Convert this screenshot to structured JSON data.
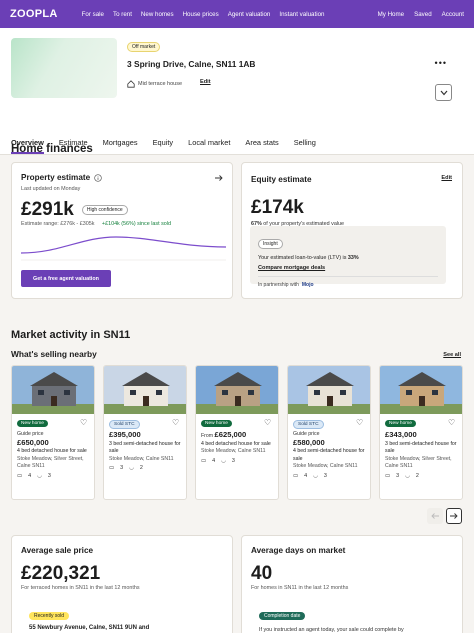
{
  "nav": {
    "logo": "ZOOPLA",
    "links": [
      "For sale",
      "To rent",
      "New homes",
      "House prices",
      "Agent valuation",
      "Instant valuation"
    ],
    "right": [
      "My Home",
      "Saved",
      "Account"
    ]
  },
  "property": {
    "status_badge": "Off market",
    "address": "3 Spring Drive, Calne, SN11 1AB",
    "type": "Mid terrace house",
    "edit_label": "Edit"
  },
  "tabs": [
    "Overview",
    "Estimate",
    "Mortgages",
    "Equity",
    "Local market",
    "Area stats",
    "Selling"
  ],
  "home_finances": {
    "heading": "Home finances",
    "estimate": {
      "title": "Property estimate",
      "updated": "Last updated on Monday",
      "value": "£291k",
      "confidence": "High confidence",
      "range": "Estimate range: £276k - £305k",
      "change": "+£104k (56%) since last sold",
      "cta": "Get a free agent valuation"
    },
    "equity": {
      "title": "Equity estimate",
      "edit_label": "Edit",
      "value": "£174k",
      "pct": "67%",
      "pct_suffix": " of your property's estimated value",
      "insight_tag": "Insight",
      "ltv_text": "Your estimated loan-to-value (LTV) is ",
      "ltv_value": "33%",
      "compare_link": "Compare mortgage deals",
      "partnership": "In partnership with",
      "partner": "Mojo"
    }
  },
  "market": {
    "heading": "Market activity in SN11",
    "subheading": "What's selling nearby",
    "see_all": "See all",
    "listings": [
      {
        "badge": "New home",
        "badge_type": "new",
        "price_prefix": "Guide price",
        "price": "£650,000",
        "desc": "4 bed detached house for sale",
        "location": "Stoke Meadow, Silver Street, Calne SN11",
        "beds": "4",
        "baths": "3",
        "photo_sky": "#8fb4d9",
        "photo_house": "#6b6f77"
      },
      {
        "badge": "Sold STC",
        "badge_type": "stc",
        "price_prefix": "",
        "price": "£395,000",
        "desc": "3 bed semi-detached house for sale",
        "location": "Stoke Meadow, Calne SN11",
        "beds": "3",
        "baths": "2",
        "photo_sky": "#c9d6e6",
        "photo_house": "#ece8df"
      },
      {
        "badge": "New home",
        "badge_type": "new",
        "price_prefix": "From ",
        "price": "£625,000",
        "desc": "4 bed detached house for sale",
        "location": "Stoke Meadow, Calne SN11",
        "beds": "4",
        "baths": "3",
        "photo_sky": "#7aa6d6",
        "photo_house": "#b9a184"
      },
      {
        "badge": "Sold STC",
        "badge_type": "stc",
        "price_prefix": "Guide price",
        "price": "£580,000",
        "desc": "4 bed semi-detached house for sale",
        "location": "Stoke Meadow, Calne SN11",
        "beds": "4",
        "baths": "3",
        "photo_sky": "#a9c4e4",
        "photo_house": "#e8e2d6"
      },
      {
        "badge": "New home",
        "badge_type": "new",
        "price_prefix": "",
        "price": "£343,000",
        "desc": "3 bed semi-detached house for sale",
        "location": "Stoke Meadow, Silver Street, Calne SN11",
        "beds": "3",
        "baths": "2",
        "photo_sky": "#8fb7df",
        "photo_house": "#c9a77b"
      }
    ]
  },
  "stats": {
    "avg_price_title": "Average sale price",
    "avg_price": "£220,321",
    "avg_price_note": "For terraced homes in SN11 in the last 12 months",
    "recent_badge": "Recently sold",
    "recent_addr": "55 Newbury Avenue, Calne, SN11 9UN and",
    "avg_days_title": "Average days on market",
    "avg_days": "40",
    "avg_days_note": "For homes in SN11 in the last 12 months",
    "completion_badge": "Completion date",
    "completion_text": "If you instructed an agent today, your sale could complete by"
  }
}
